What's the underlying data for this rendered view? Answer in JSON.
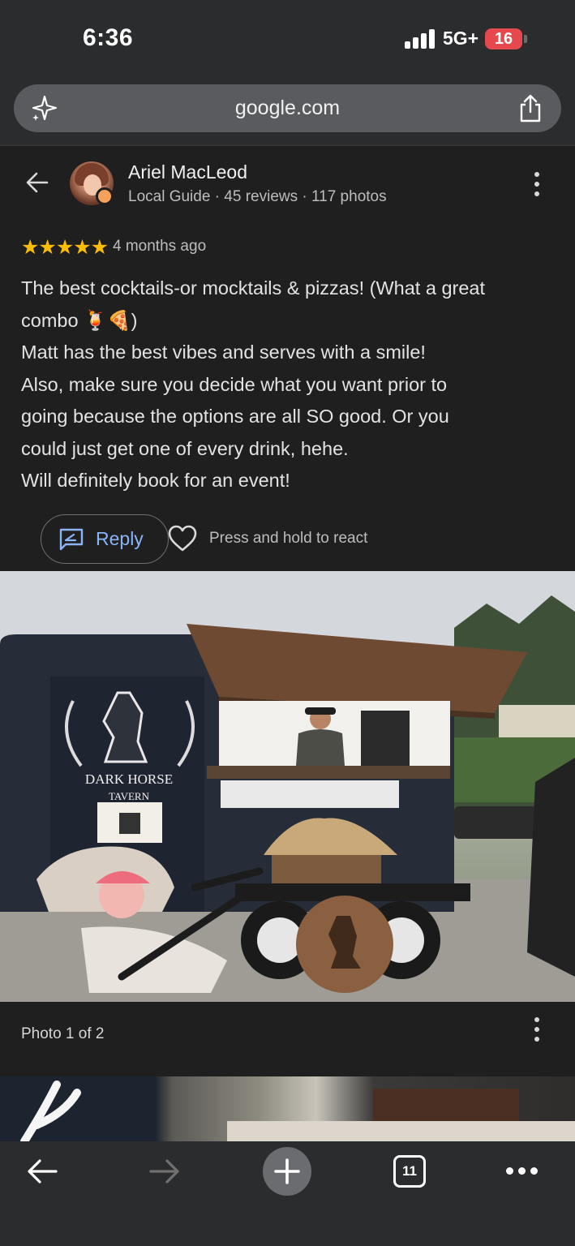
{
  "status": {
    "time": "6:36",
    "network": "5G+",
    "battery": "16"
  },
  "browser": {
    "url": "google.com",
    "icons": [
      "sparkle-icon",
      "share-icon"
    ]
  },
  "review": {
    "reviewer_name": "Ariel MacLeod",
    "reviewer_meta": "Local Guide · 45 reviews · 117 photos",
    "rating": 5,
    "stars_text": "★★★★★",
    "date": "4 months ago",
    "text_lines": [
      "The best cocktails-or mocktails & pizzas! (What a great",
      "combo 🍹🍕)",
      "Matt has the best vibes and serves with a smile!",
      "Also, make sure you decide what you want prior to",
      "going because the options are all SO good. Or you",
      "could just get one of every drink, hehe.",
      "Will definitely book for an event!"
    ],
    "reply_label": "Reply",
    "react_hint": "Press and hold to react"
  },
  "photo": {
    "caption": "Photo 1 of 2",
    "sign_line1": "DARK HORSE",
    "sign_line2": "TAVERN"
  },
  "toolbar": {
    "tab_count": "11"
  },
  "colors": {
    "background": "#1f1f1f",
    "chrome": "#2b2c2e",
    "accent_blue": "#8ab4f8",
    "star": "#fbbc04",
    "battery_red": "#e5484d"
  }
}
